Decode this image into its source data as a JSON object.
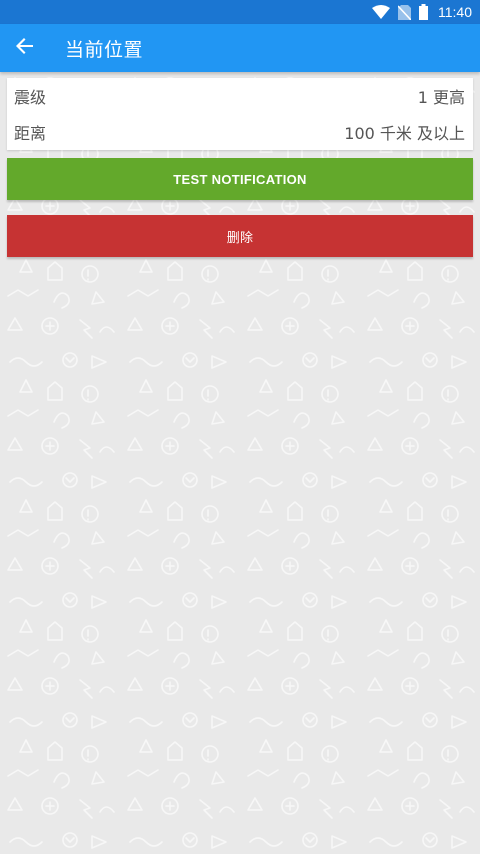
{
  "status_bar": {
    "time": "11:40",
    "icons": [
      "wifi-icon",
      "no-sim-icon",
      "battery-icon"
    ]
  },
  "app_bar": {
    "title": "当前位置",
    "back_icon": "arrow-left-icon"
  },
  "settings": {
    "magnitude": {
      "label": "震级",
      "value": "1 更高"
    },
    "distance": {
      "label": "距离",
      "value": "100 千米 及以上"
    }
  },
  "buttons": {
    "test_notification": "TEST NOTIFICATION",
    "delete": "删除"
  },
  "colors": {
    "status_bar": "#1b76d2",
    "app_bar": "#2196f3",
    "test_button": "#63a92b",
    "delete_button": "#c63333",
    "background": "#e9e9e9"
  }
}
